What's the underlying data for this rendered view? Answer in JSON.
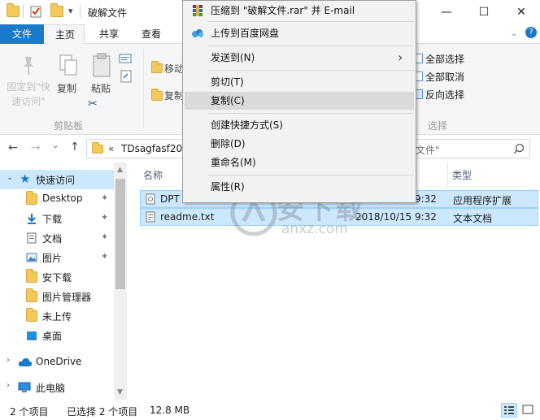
{
  "titlebar": {
    "title": "破解文件",
    "dropdown_glyph": "▾",
    "minimize_glyph": "—",
    "maximize_glyph": "☐",
    "close_glyph": "✕"
  },
  "ribbon_tabs": {
    "file": "文件",
    "home": "主页",
    "share": "共享",
    "view": "查看"
  },
  "ribbon": {
    "pin_label": "固定到\"快\n速访问\"",
    "copy_label": "复制",
    "paste_label": "粘贴",
    "clipboard_group": "剪贴板",
    "move_to_partial": "移动",
    "copy_to_partial": "复制",
    "select_all": "全部选择",
    "select_none": "全部取消",
    "invert_selection": "反向选择",
    "select_group": "选择"
  },
  "address": {
    "chevrons": "«",
    "path_visible": "TDsagfasf201",
    "search_visible": "文件\""
  },
  "nav": {
    "quick_access": "快速访问",
    "items": [
      {
        "label": "Desktop",
        "pinned": true
      },
      {
        "label": "下载",
        "pinned": true
      },
      {
        "label": "文档",
        "pinned": true
      },
      {
        "label": "图片",
        "pinned": true
      },
      {
        "label": "安下载",
        "pinned": false
      },
      {
        "label": "图片管理器",
        "pinned": false
      },
      {
        "label": "未上传",
        "pinned": false
      },
      {
        "label": "桌面",
        "pinned": false
      }
    ],
    "onedrive": "OneDrive",
    "this_pc": "此电脑",
    "pin_glyph": "📌"
  },
  "filelist": {
    "headers": {
      "name": "名称",
      "type": "类型"
    },
    "rows": [
      {
        "name": "DPT",
        "date": "2018/10/15 9:32",
        "type": "应用程序扩展"
      },
      {
        "name": "readme.txt",
        "date": "2018/10/15 9:32",
        "type": "文本文档"
      }
    ]
  },
  "watermark": {
    "line1": "安下载",
    "line2": "anxz.com"
  },
  "statusbar": {
    "count": "2 个项目",
    "selected": "已选择 2 个项目",
    "size": "12.8 MB"
  },
  "context_menu": {
    "items": [
      {
        "label": "压缩到 \"破解文件.rar\" 并 E-mail",
        "icon": "winrar-icon"
      },
      {
        "label": "上传到百度网盘",
        "icon": "baidu-cloud-icon"
      },
      {
        "label": "发送到(N)",
        "submenu": true
      },
      {
        "label": "剪切(T)"
      },
      {
        "label": "复制(C)",
        "highlighted": true
      },
      {
        "label": "创建快捷方式(S)"
      },
      {
        "label": "删除(D)"
      },
      {
        "label": "重命名(M)"
      },
      {
        "label": "属性(R)"
      }
    ],
    "submenu_arrow": "›"
  },
  "colors": {
    "accent": "#1979ca",
    "selection_fill": "#cce8ff",
    "selection_border": "#99d1ff",
    "menu_bg": "#f2f2f2",
    "menu_highlight": "#dadada"
  }
}
